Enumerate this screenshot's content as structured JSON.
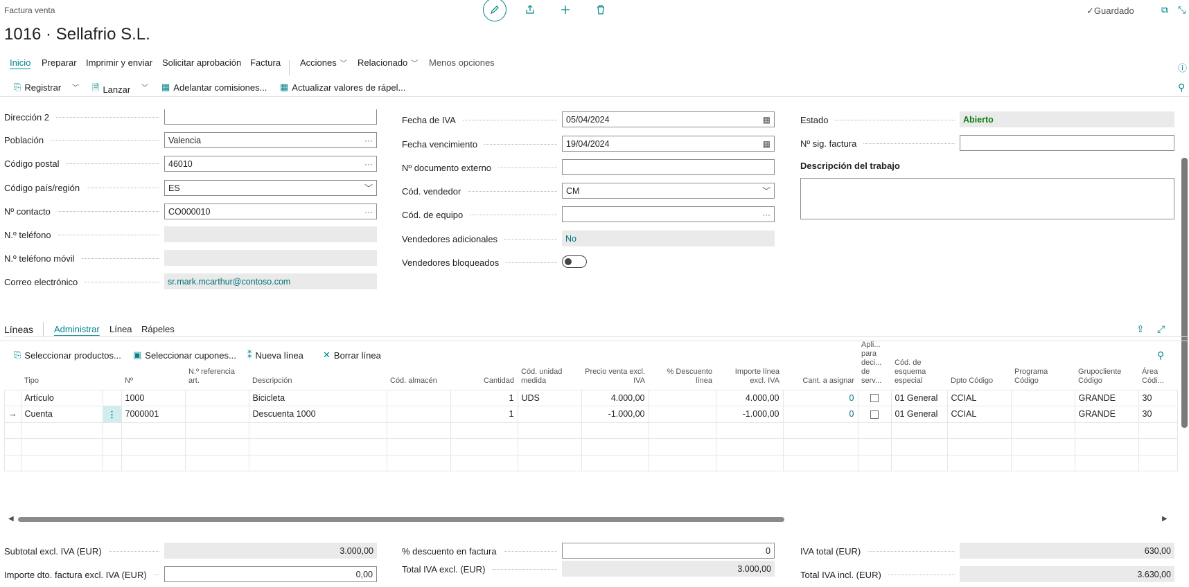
{
  "header": {
    "page_type": "Factura venta",
    "title": "1016 · Sellafrio S.L.",
    "saved_label": "Guardado"
  },
  "menu": {
    "items": [
      "Inicio",
      "Preparar",
      "Imprimir y enviar",
      "Solicitar aprobación",
      "Factura"
    ],
    "dropdowns": [
      "Acciones",
      "Relacionado"
    ],
    "less_options": "Menos opciones"
  },
  "actions": {
    "registrar": "Registrar",
    "lanzar": "Lanzar",
    "adelantar": "Adelantar comisiones...",
    "actualizar": "Actualizar valores de rápel..."
  },
  "fields_left": [
    {
      "label": "Dirección 2",
      "value": "",
      "kind": "input"
    },
    {
      "label": "Población",
      "value": "Valencia",
      "kind": "lookup"
    },
    {
      "label": "Código postal",
      "value": "46010",
      "kind": "lookup"
    },
    {
      "label": "Código país/región",
      "value": "ES",
      "kind": "select"
    },
    {
      "label": "Nº contacto",
      "value": "CO000010",
      "kind": "lookup"
    },
    {
      "label": "N.º teléfono",
      "value": "",
      "kind": "readonly"
    },
    {
      "label": "N.º teléfono móvil",
      "value": "",
      "kind": "readonly"
    },
    {
      "label": "Correo electrónico",
      "value": "sr.mark.mcarthur@contoso.com",
      "kind": "link"
    }
  ],
  "fields_mid": [
    {
      "label": "Fecha de IVA",
      "value": "05/04/2024",
      "kind": "date"
    },
    {
      "label": "Fecha vencimiento",
      "value": "19/04/2024",
      "kind": "date"
    },
    {
      "label": "Nº documento externo",
      "value": "",
      "kind": "input"
    },
    {
      "label": "Cód. vendedor",
      "value": "CM",
      "kind": "select"
    },
    {
      "label": "Cód. de equipo",
      "value": "",
      "kind": "lookup"
    },
    {
      "label": "Vendedores adicionales",
      "value": "No",
      "kind": "link"
    },
    {
      "label": "Vendedores bloqueados",
      "value": "",
      "kind": "toggle"
    }
  ],
  "fields_right": {
    "estado_label": "Estado",
    "estado_value": "Abierto",
    "sig_factura_label": "Nº sig. factura",
    "sig_factura_value": "",
    "descripcion_label": "Descripción del trabajo"
  },
  "lines": {
    "title": "Líneas",
    "tabs": [
      "Administrar",
      "Línea",
      "Rápeles"
    ],
    "actions": [
      "Seleccionar productos...",
      "Seleccionar cupones...",
      "Nueva línea",
      "Borrar línea"
    ],
    "columns": [
      "Tipo",
      "",
      "Nº",
      "N.º referencia art.",
      "Descripción",
      "Cód. almacén",
      "Cantidad",
      "Cód. unidad medida",
      "Precio venta excl. IVA",
      "% Descuento línea",
      "Importe línea excl. IVA",
      "Cant. a asignar",
      "Apli... para deci... de serv...",
      "Cód. de esquema especial",
      "Dpto Código",
      "Programa Código",
      "Grupocliente Código",
      "Área Códi..."
    ],
    "rows": [
      {
        "marker": "",
        "tipo": "Artículo",
        "no": "1000",
        "ref": "",
        "desc": "Bicicleta",
        "alm": "",
        "cant": "1",
        "ud": "UDS",
        "precio": "4.000,00",
        "dto": "",
        "importe": "4.000,00",
        "asignar": "0",
        "esquema": "01 General",
        "dpto": "CCIAL",
        "programa": "",
        "grupo": "GRANDE",
        "area": "30"
      },
      {
        "marker": "→",
        "tipo": "Cuenta",
        "no": "7000001",
        "ref": "",
        "desc": "Descuenta 1000",
        "alm": "",
        "cant": "1",
        "ud": "",
        "precio": "-1.000,00",
        "dto": "",
        "importe": "-1.000,00",
        "asignar": "0",
        "esquema": "01 General",
        "dpto": "CCIAL",
        "programa": "",
        "grupo": "GRANDE",
        "area": "30"
      }
    ]
  },
  "totals": {
    "subtotal_label": "Subtotal excl. IVA (EUR)",
    "subtotal_value": "3.000,00",
    "importe_dto_label": "Importe dto. factura excl. IVA (EUR)",
    "importe_dto_value": "0,00",
    "pct_dto_label": "% descuento en factura",
    "pct_dto_value": "0",
    "total_excl_label": "Total IVA excl. (EUR)",
    "total_excl_value": "3.000,00",
    "iva_total_label": "IVA total (EUR)",
    "iva_total_value": "630,00",
    "total_incl_label": "Total IVA incl. (EUR)",
    "total_incl_value": "3.630,00"
  },
  "colors": {
    "accent": "#008489",
    "link": "#00727a",
    "status_open": "#107c10"
  }
}
